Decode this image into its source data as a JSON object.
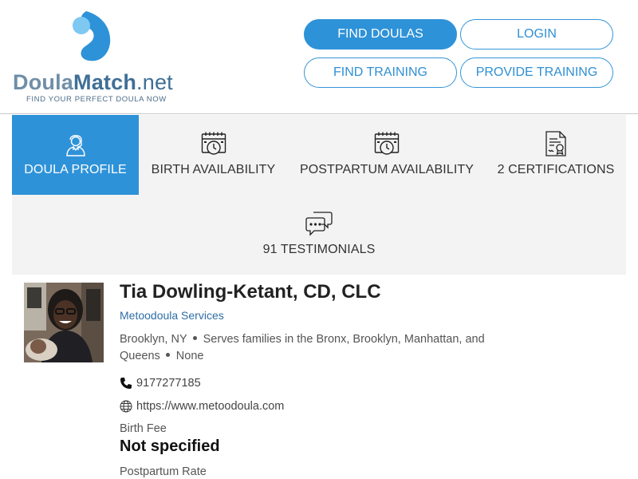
{
  "header": {
    "logo": {
      "name_part1": "Doula",
      "name_part2": "Match",
      "name_part3": ".net",
      "tagline": "FIND YOUR PERFECT DOULA NOW"
    },
    "nav": {
      "find_doulas": "FIND DOULAS",
      "login": "LOGIN",
      "find_training": "FIND TRAINING",
      "provide_training": "PROVIDE TRAINING"
    }
  },
  "tabs": [
    {
      "label": "DOULA PROFILE",
      "icon": "person-icon",
      "active": true
    },
    {
      "label": "BIRTH AVAILABILITY",
      "icon": "calendar-clock-icon",
      "active": false
    },
    {
      "label": "POSTPARTUM AVAILABILITY",
      "icon": "calendar-clock-icon",
      "active": false
    },
    {
      "label": "2 CERTIFICATIONS",
      "icon": "certificate-icon",
      "active": false
    },
    {
      "label": "91 TESTIMONIALS",
      "icon": "chat-bubbles-icon",
      "active": false
    }
  ],
  "profile": {
    "name": "Tia Dowling-Ketant, CD, CLC",
    "company": "Metoodoula Services",
    "city": "Brooklyn, NY",
    "serves_line1": "Serves families in the Bronx, Brooklyn, Manhattan, and",
    "serves_line2": "Queens",
    "languages": "None",
    "phone": "9177277185",
    "website": "https://www.metoodoula.com",
    "birth_fee_label": "Birth Fee",
    "birth_fee_value": "Not specified",
    "postpartum_rate_label": "Postpartum Rate"
  },
  "colors": {
    "primary_blue": "#2e92d8",
    "tab_background": "#f3f3f3",
    "link_blue": "#2f6ea6"
  }
}
